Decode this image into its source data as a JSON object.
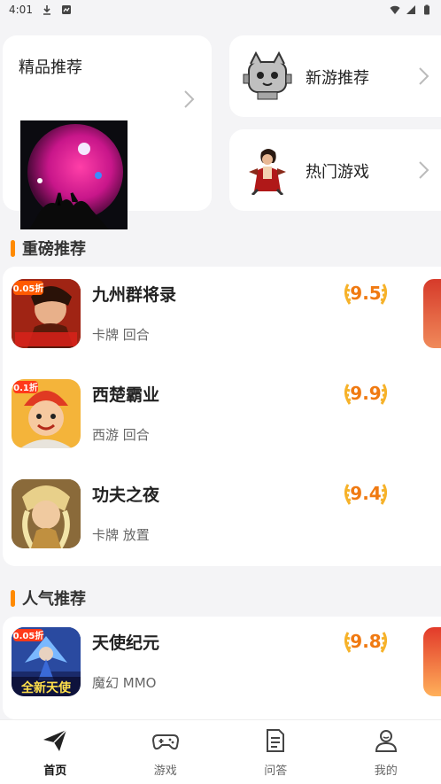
{
  "status_bar": {
    "time": "4:01"
  },
  "featured": {
    "title": "精品推荐"
  },
  "new_games": {
    "title": "新游推荐"
  },
  "hot_games": {
    "title": "热门游戏"
  },
  "sections": {
    "heavy": {
      "title": "重磅推荐"
    },
    "popular": {
      "title": "人气推荐"
    }
  },
  "heavy_games": [
    {
      "name": "九州群将录",
      "tags": "卡牌 回合",
      "score": "9.5"
    },
    {
      "name": "西楚霸业",
      "tags": "西游 回合",
      "score": "9.9"
    },
    {
      "name": "功夫之夜",
      "tags": "卡牌 放置",
      "score": "9.4"
    }
  ],
  "popular_games": [
    {
      "name": "天使纪元",
      "tags": "魔幻 MMO",
      "score": "9.8"
    }
  ],
  "icon_badges": {
    "jiuzhou": "0.05折",
    "xichu": "0.1折",
    "tianshi_top": "0.05折",
    "tianshi_bottom": "全新天使"
  },
  "tabs": [
    {
      "label": "首页",
      "active": true
    },
    {
      "label": "游戏",
      "active": false
    },
    {
      "label": "问答",
      "active": false
    },
    {
      "label": "我的",
      "active": false
    }
  ],
  "colors": {
    "accent": "#ff8a00",
    "score": "#f07a12",
    "background": "#f4f4f6"
  }
}
